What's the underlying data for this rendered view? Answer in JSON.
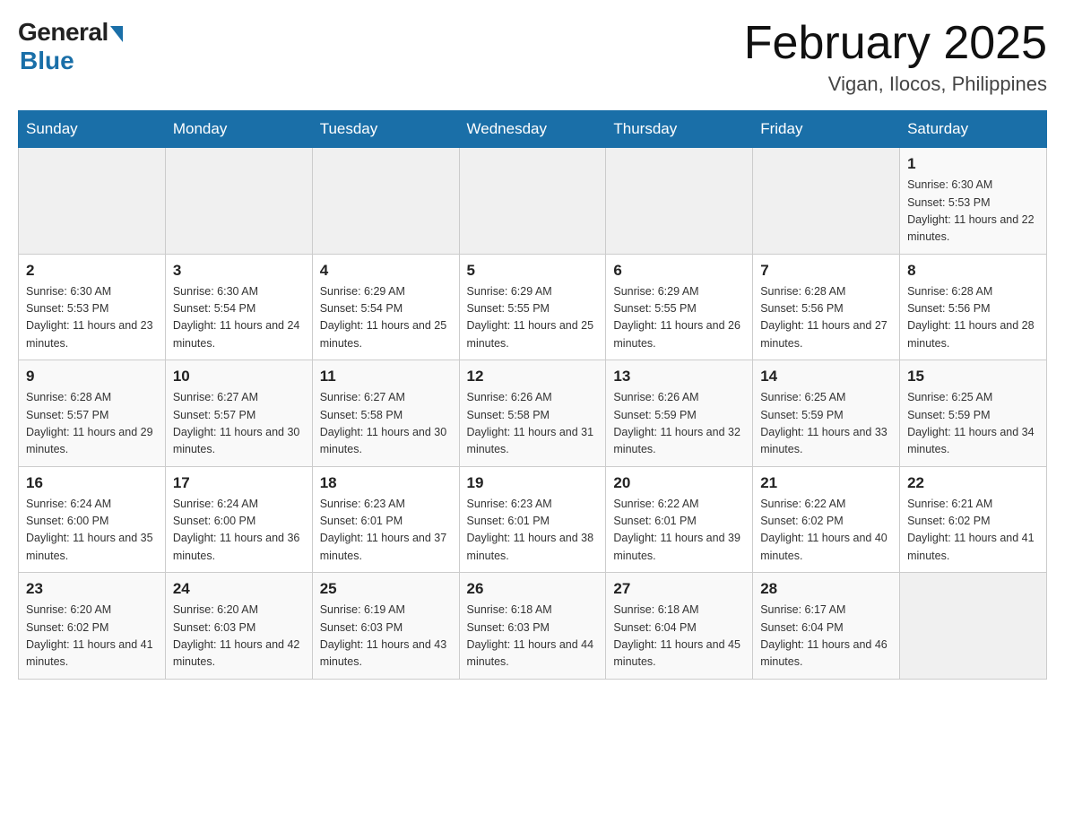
{
  "header": {
    "logo_general": "General",
    "logo_blue": "Blue",
    "month_year": "February 2025",
    "location": "Vigan, Ilocos, Philippines"
  },
  "days_of_week": [
    "Sunday",
    "Monday",
    "Tuesday",
    "Wednesday",
    "Thursday",
    "Friday",
    "Saturday"
  ],
  "weeks": [
    [
      {
        "day": "",
        "sunrise": "",
        "sunset": "",
        "daylight": ""
      },
      {
        "day": "",
        "sunrise": "",
        "sunset": "",
        "daylight": ""
      },
      {
        "day": "",
        "sunrise": "",
        "sunset": "",
        "daylight": ""
      },
      {
        "day": "",
        "sunrise": "",
        "sunset": "",
        "daylight": ""
      },
      {
        "day": "",
        "sunrise": "",
        "sunset": "",
        "daylight": ""
      },
      {
        "day": "",
        "sunrise": "",
        "sunset": "",
        "daylight": ""
      },
      {
        "day": "1",
        "sunrise": "Sunrise: 6:30 AM",
        "sunset": "Sunset: 5:53 PM",
        "daylight": "Daylight: 11 hours and 22 minutes."
      }
    ],
    [
      {
        "day": "2",
        "sunrise": "Sunrise: 6:30 AM",
        "sunset": "Sunset: 5:53 PM",
        "daylight": "Daylight: 11 hours and 23 minutes."
      },
      {
        "day": "3",
        "sunrise": "Sunrise: 6:30 AM",
        "sunset": "Sunset: 5:54 PM",
        "daylight": "Daylight: 11 hours and 24 minutes."
      },
      {
        "day": "4",
        "sunrise": "Sunrise: 6:29 AM",
        "sunset": "Sunset: 5:54 PM",
        "daylight": "Daylight: 11 hours and 25 minutes."
      },
      {
        "day": "5",
        "sunrise": "Sunrise: 6:29 AM",
        "sunset": "Sunset: 5:55 PM",
        "daylight": "Daylight: 11 hours and 25 minutes."
      },
      {
        "day": "6",
        "sunrise": "Sunrise: 6:29 AM",
        "sunset": "Sunset: 5:55 PM",
        "daylight": "Daylight: 11 hours and 26 minutes."
      },
      {
        "day": "7",
        "sunrise": "Sunrise: 6:28 AM",
        "sunset": "Sunset: 5:56 PM",
        "daylight": "Daylight: 11 hours and 27 minutes."
      },
      {
        "day": "8",
        "sunrise": "Sunrise: 6:28 AM",
        "sunset": "Sunset: 5:56 PM",
        "daylight": "Daylight: 11 hours and 28 minutes."
      }
    ],
    [
      {
        "day": "9",
        "sunrise": "Sunrise: 6:28 AM",
        "sunset": "Sunset: 5:57 PM",
        "daylight": "Daylight: 11 hours and 29 minutes."
      },
      {
        "day": "10",
        "sunrise": "Sunrise: 6:27 AM",
        "sunset": "Sunset: 5:57 PM",
        "daylight": "Daylight: 11 hours and 30 minutes."
      },
      {
        "day": "11",
        "sunrise": "Sunrise: 6:27 AM",
        "sunset": "Sunset: 5:58 PM",
        "daylight": "Daylight: 11 hours and 30 minutes."
      },
      {
        "day": "12",
        "sunrise": "Sunrise: 6:26 AM",
        "sunset": "Sunset: 5:58 PM",
        "daylight": "Daylight: 11 hours and 31 minutes."
      },
      {
        "day": "13",
        "sunrise": "Sunrise: 6:26 AM",
        "sunset": "Sunset: 5:59 PM",
        "daylight": "Daylight: 11 hours and 32 minutes."
      },
      {
        "day": "14",
        "sunrise": "Sunrise: 6:25 AM",
        "sunset": "Sunset: 5:59 PM",
        "daylight": "Daylight: 11 hours and 33 minutes."
      },
      {
        "day": "15",
        "sunrise": "Sunrise: 6:25 AM",
        "sunset": "Sunset: 5:59 PM",
        "daylight": "Daylight: 11 hours and 34 minutes."
      }
    ],
    [
      {
        "day": "16",
        "sunrise": "Sunrise: 6:24 AM",
        "sunset": "Sunset: 6:00 PM",
        "daylight": "Daylight: 11 hours and 35 minutes."
      },
      {
        "day": "17",
        "sunrise": "Sunrise: 6:24 AM",
        "sunset": "Sunset: 6:00 PM",
        "daylight": "Daylight: 11 hours and 36 minutes."
      },
      {
        "day": "18",
        "sunrise": "Sunrise: 6:23 AM",
        "sunset": "Sunset: 6:01 PM",
        "daylight": "Daylight: 11 hours and 37 minutes."
      },
      {
        "day": "19",
        "sunrise": "Sunrise: 6:23 AM",
        "sunset": "Sunset: 6:01 PM",
        "daylight": "Daylight: 11 hours and 38 minutes."
      },
      {
        "day": "20",
        "sunrise": "Sunrise: 6:22 AM",
        "sunset": "Sunset: 6:01 PM",
        "daylight": "Daylight: 11 hours and 39 minutes."
      },
      {
        "day": "21",
        "sunrise": "Sunrise: 6:22 AM",
        "sunset": "Sunset: 6:02 PM",
        "daylight": "Daylight: 11 hours and 40 minutes."
      },
      {
        "day": "22",
        "sunrise": "Sunrise: 6:21 AM",
        "sunset": "Sunset: 6:02 PM",
        "daylight": "Daylight: 11 hours and 41 minutes."
      }
    ],
    [
      {
        "day": "23",
        "sunrise": "Sunrise: 6:20 AM",
        "sunset": "Sunset: 6:02 PM",
        "daylight": "Daylight: 11 hours and 41 minutes."
      },
      {
        "day": "24",
        "sunrise": "Sunrise: 6:20 AM",
        "sunset": "Sunset: 6:03 PM",
        "daylight": "Daylight: 11 hours and 42 minutes."
      },
      {
        "day": "25",
        "sunrise": "Sunrise: 6:19 AM",
        "sunset": "Sunset: 6:03 PM",
        "daylight": "Daylight: 11 hours and 43 minutes."
      },
      {
        "day": "26",
        "sunrise": "Sunrise: 6:18 AM",
        "sunset": "Sunset: 6:03 PM",
        "daylight": "Daylight: 11 hours and 44 minutes."
      },
      {
        "day": "27",
        "sunrise": "Sunrise: 6:18 AM",
        "sunset": "Sunset: 6:04 PM",
        "daylight": "Daylight: 11 hours and 45 minutes."
      },
      {
        "day": "28",
        "sunrise": "Sunrise: 6:17 AM",
        "sunset": "Sunset: 6:04 PM",
        "daylight": "Daylight: 11 hours and 46 minutes."
      },
      {
        "day": "",
        "sunrise": "",
        "sunset": "",
        "daylight": ""
      }
    ]
  ]
}
